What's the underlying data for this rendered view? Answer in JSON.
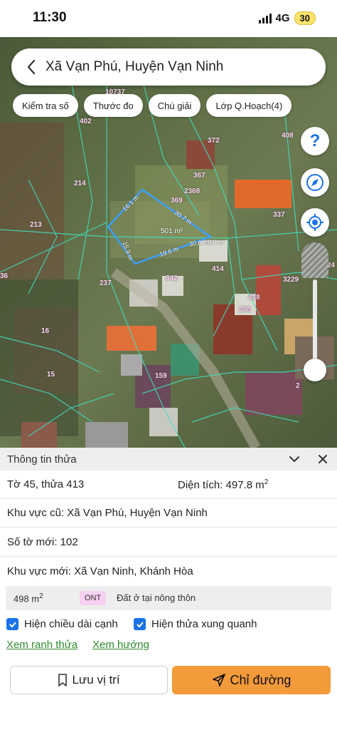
{
  "status_bar": {
    "time": "11:30",
    "network": "4G",
    "battery": "30"
  },
  "search": {
    "title": "Xã Vạn Phú, Huyện Vạn Ninh"
  },
  "chips": [
    "Kiểm tra số",
    "Thước đo",
    "Chú giải",
    "Lớp Q.Hoạch(4)"
  ],
  "map": {
    "parcel_labels": [
      "10737",
      "402",
      "372",
      "408",
      "367",
      "2368",
      "214",
      "369",
      "337",
      "213",
      "501 m²",
      "342",
      "414",
      "36",
      "237",
      "418",
      "3229",
      "24",
      "238",
      "16",
      "15",
      "159",
      "2"
    ],
    "edge_labels": [
      "16.1 m",
      "30.7 m",
      "15.9 m",
      "19.6 m",
      "30.0 m",
      "8.0 m"
    ]
  },
  "panel": {
    "title": "Thông tin thửa",
    "sheet_plot": "Tờ 45, thửa 413",
    "area_label": "Diện tích: 497.8 m",
    "area_sup": "2",
    "old_region": "Khu vực cũ: Xã Vạn Phú, Huyện Vạn Ninh",
    "new_sheet": "Số tờ mới: 102",
    "new_region": "Khu vực mới: Xã Vạn Ninh, Khánh Hòa",
    "zone": {
      "area": "498 m",
      "area_sup": "2",
      "code": "ONT",
      "description": "Đất ở tại nông thôn"
    },
    "checkbox_edges": "Hiện chiều dài cạnh",
    "checkbox_neighbors": "Hiện thửa xung quanh",
    "link_boundary": "Xem ranh thửa",
    "link_direction": "Xem hướng"
  },
  "actions": {
    "save": "Lưu vị trí",
    "route": "Chỉ đường"
  },
  "colors": {
    "accent": "#f39a3a",
    "checkbox": "#1a73e8",
    "link": "#2e8b2e",
    "parcel_outline": "#3aa0ff",
    "grid_line": "#3fe0c0",
    "zone_badge": "#f7d0ef"
  },
  "icons": {
    "back": "chevron-left-icon",
    "help": "question-icon",
    "compass": "compass-icon",
    "locate": "crosshair-icon",
    "collapse": "chevron-down-icon",
    "close": "close-icon",
    "bookmark": "bookmark-icon",
    "send": "send-icon"
  }
}
